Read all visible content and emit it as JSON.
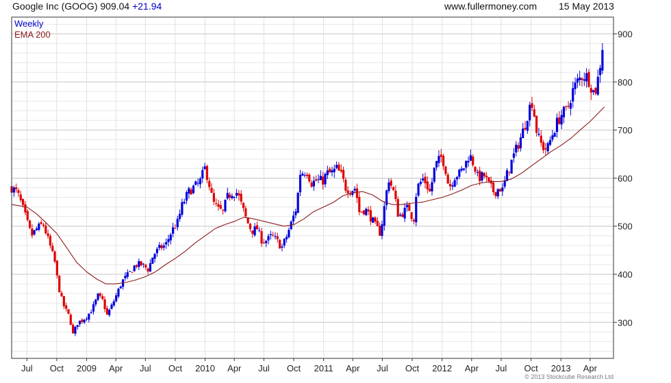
{
  "header": {
    "title": "Google Inc (GOOG) 909.04",
    "change": "+21.94",
    "site": "www.fullermoney.com",
    "date": "15 May 2013"
  },
  "footer": {
    "copyright": "© 2013 Stockcube Research Ltd"
  },
  "colors": {
    "up": "#0000dd",
    "down": "#dd0000",
    "ema": "#8b1a1a",
    "grid": "#c8c8c8",
    "axis": "#333333"
  },
  "chart_data": {
    "type": "candlestick",
    "frequency": "weekly",
    "legend": [
      "Weekly",
      "EMA 200"
    ],
    "legend_placement": "top-left",
    "y_axis": {
      "position": "right",
      "ticks": [
        300,
        400,
        500,
        600,
        700,
        800,
        900
      ],
      "range": [
        225,
        935
      ]
    },
    "grid": true,
    "x_ticks": [
      {
        "label": "Jul",
        "date": "2008-07-01"
      },
      {
        "label": "Oct",
        "date": "2008-10-01"
      },
      {
        "label": "2009",
        "date": "2009-01-01"
      },
      {
        "label": "Apr",
        "date": "2009-04-01"
      },
      {
        "label": "Jul",
        "date": "2009-07-01"
      },
      {
        "label": "Oct",
        "date": "2009-10-01"
      },
      {
        "label": "2010",
        "date": "2010-01-01"
      },
      {
        "label": "Apr",
        "date": "2010-04-01"
      },
      {
        "label": "Jul",
        "date": "2010-07-01"
      },
      {
        "label": "Oct",
        "date": "2010-10-01"
      },
      {
        "label": "2011",
        "date": "2011-01-01"
      },
      {
        "label": "Apr",
        "date": "2011-04-01"
      },
      {
        "label": "Jul",
        "date": "2011-07-01"
      },
      {
        "label": "Oct",
        "date": "2011-10-01"
      },
      {
        "label": "2012",
        "date": "2012-01-01"
      },
      {
        "label": "Apr",
        "date": "2012-04-01"
      },
      {
        "label": "Jul",
        "date": "2012-07-01"
      },
      {
        "label": "Oct",
        "date": "2012-10-01"
      },
      {
        "label": "2013",
        "date": "2013-01-01"
      },
      {
        "label": "Apr",
        "date": "2013-04-01"
      }
    ],
    "x_range": [
      "2008-05-15",
      "2013-06-12"
    ],
    "price_path": [
      [
        "2008-05-15",
        580
      ],
      [
        "2008-06-01",
        570
      ],
      [
        "2008-06-15",
        545
      ],
      [
        "2008-07-01",
        510
      ],
      [
        "2008-07-15",
        480
      ],
      [
        "2008-08-01",
        495
      ],
      [
        "2008-08-20",
        505
      ],
      [
        "2008-09-10",
        460
      ],
      [
        "2008-09-25",
        425
      ],
      [
        "2008-10-05",
        380
      ],
      [
        "2008-10-15",
        350
      ],
      [
        "2008-10-25",
        330
      ],
      [
        "2008-11-10",
        310
      ],
      [
        "2008-11-20",
        275
      ],
      [
        "2008-12-05",
        300
      ],
      [
        "2008-12-20",
        305
      ],
      [
        "2009-01-05",
        315
      ],
      [
        "2009-01-20",
        330
      ],
      [
        "2009-02-05",
        355
      ],
      [
        "2009-02-20",
        345
      ],
      [
        "2009-03-05",
        315
      ],
      [
        "2009-03-20",
        335
      ],
      [
        "2009-04-05",
        360
      ],
      [
        "2009-04-20",
        385
      ],
      [
        "2009-05-10",
        400
      ],
      [
        "2009-06-01",
        420
      ],
      [
        "2009-06-20",
        420
      ],
      [
        "2009-07-10",
        410
      ],
      [
        "2009-07-25",
        440
      ],
      [
        "2009-08-15",
        455
      ],
      [
        "2009-09-01",
        460
      ],
      [
        "2009-09-20",
        490
      ],
      [
        "2009-10-10",
        510
      ],
      [
        "2009-10-20",
        540
      ],
      [
        "2009-11-10",
        570
      ],
      [
        "2009-11-25",
        580
      ],
      [
        "2009-12-15",
        590
      ],
      [
        "2009-12-31",
        620
      ],
      [
        "2010-01-10",
        600
      ],
      [
        "2010-01-25",
        550
      ],
      [
        "2010-02-10",
        535
      ],
      [
        "2010-02-25",
        530
      ],
      [
        "2010-03-10",
        560
      ],
      [
        "2010-03-25",
        570
      ],
      [
        "2010-04-10",
        570
      ],
      [
        "2010-04-25",
        540
      ],
      [
        "2010-05-10",
        510
      ],
      [
        "2010-05-25",
        490
      ],
      [
        "2010-06-10",
        495
      ],
      [
        "2010-06-25",
        470
      ],
      [
        "2010-07-10",
        470
      ],
      [
        "2010-07-25",
        480
      ],
      [
        "2010-08-10",
        470
      ],
      [
        "2010-08-25",
        455
      ],
      [
        "2010-09-10",
        480
      ],
      [
        "2010-09-25",
        510
      ],
      [
        "2010-10-10",
        540
      ],
      [
        "2010-10-20",
        610
      ],
      [
        "2010-11-10",
        615
      ],
      [
        "2010-11-25",
        590
      ],
      [
        "2010-12-10",
        595
      ],
      [
        "2010-12-31",
        595
      ],
      [
        "2011-01-10",
        610
      ],
      [
        "2011-01-25",
        610
      ],
      [
        "2011-02-10",
        620
      ],
      [
        "2011-02-25",
        605
      ],
      [
        "2011-03-10",
        580
      ],
      [
        "2011-03-25",
        575
      ],
      [
        "2011-04-10",
        580
      ],
      [
        "2011-04-20",
        530
      ],
      [
        "2011-05-10",
        535
      ],
      [
        "2011-05-25",
        520
      ],
      [
        "2011-06-10",
        500
      ],
      [
        "2011-06-25",
        485
      ],
      [
        "2011-07-05",
        530
      ],
      [
        "2011-07-20",
        600
      ],
      [
        "2011-08-05",
        570
      ],
      [
        "2011-08-20",
        520
      ],
      [
        "2011-09-05",
        530
      ],
      [
        "2011-09-20",
        540
      ],
      [
        "2011-10-05",
        510
      ],
      [
        "2011-10-15",
        580
      ],
      [
        "2011-11-05",
        600
      ],
      [
        "2011-11-25",
        570
      ],
      [
        "2011-12-10",
        625
      ],
      [
        "2011-12-31",
        645
      ],
      [
        "2012-01-10",
        625
      ],
      [
        "2012-01-22",
        580
      ],
      [
        "2012-02-10",
        605
      ],
      [
        "2012-02-25",
        610
      ],
      [
        "2012-03-10",
        625
      ],
      [
        "2012-03-25",
        650
      ],
      [
        "2012-04-10",
        625
      ],
      [
        "2012-04-20",
        600
      ],
      [
        "2012-05-10",
        605
      ],
      [
        "2012-05-25",
        585
      ],
      [
        "2012-06-10",
        570
      ],
      [
        "2012-06-25",
        580
      ],
      [
        "2012-07-05",
        575
      ],
      [
        "2012-07-20",
        610
      ],
      [
        "2012-08-05",
        640
      ],
      [
        "2012-08-25",
        675
      ],
      [
        "2012-09-10",
        705
      ],
      [
        "2012-09-25",
        745
      ],
      [
        "2012-10-05",
        760
      ],
      [
        "2012-10-20",
        690
      ],
      [
        "2012-11-05",
        665
      ],
      [
        "2012-11-20",
        660
      ],
      [
        "2012-12-05",
        690
      ],
      [
        "2012-12-20",
        715
      ],
      [
        "2013-01-05",
        735
      ],
      [
        "2013-01-20",
        740
      ],
      [
        "2013-02-05",
        780
      ],
      [
        "2013-02-20",
        800
      ],
      [
        "2013-03-10",
        815
      ],
      [
        "2013-03-25",
        810
      ],
      [
        "2013-04-10",
        780
      ],
      [
        "2013-04-20",
        785
      ],
      [
        "2013-05-05",
        850
      ],
      [
        "2013-05-15",
        909
      ]
    ],
    "ema_200": [
      [
        "2008-05-15",
        545
      ],
      [
        "2008-07-01",
        540
      ],
      [
        "2008-08-01",
        525
      ],
      [
        "2008-09-01",
        505
      ],
      [
        "2008-10-01",
        485
      ],
      [
        "2008-11-01",
        455
      ],
      [
        "2008-12-01",
        425
      ],
      [
        "2009-01-01",
        405
      ],
      [
        "2009-02-01",
        390
      ],
      [
        "2009-03-01",
        380
      ],
      [
        "2009-04-01",
        380
      ],
      [
        "2009-05-01",
        383
      ],
      [
        "2009-06-01",
        388
      ],
      [
        "2009-07-01",
        395
      ],
      [
        "2009-08-01",
        405
      ],
      [
        "2009-09-01",
        420
      ],
      [
        "2009-10-01",
        433
      ],
      [
        "2009-11-01",
        448
      ],
      [
        "2009-12-01",
        465
      ],
      [
        "2010-01-01",
        480
      ],
      [
        "2010-02-01",
        495
      ],
      [
        "2010-03-01",
        503
      ],
      [
        "2010-04-01",
        510
      ],
      [
        "2010-05-01",
        519
      ],
      [
        "2010-06-01",
        515
      ],
      [
        "2010-07-01",
        510
      ],
      [
        "2010-08-01",
        505
      ],
      [
        "2010-09-01",
        500
      ],
      [
        "2010-10-01",
        503
      ],
      [
        "2010-11-01",
        515
      ],
      [
        "2010-12-01",
        530
      ],
      [
        "2011-01-01",
        540
      ],
      [
        "2011-02-01",
        550
      ],
      [
        "2011-03-01",
        563
      ],
      [
        "2011-04-01",
        570
      ],
      [
        "2011-05-01",
        572
      ],
      [
        "2011-06-01",
        565
      ],
      [
        "2011-07-01",
        552
      ],
      [
        "2011-08-01",
        545
      ],
      [
        "2011-09-01",
        545
      ],
      [
        "2011-10-01",
        548
      ],
      [
        "2011-11-01",
        550
      ],
      [
        "2011-12-01",
        555
      ],
      [
        "2012-01-01",
        560
      ],
      [
        "2012-02-01",
        567
      ],
      [
        "2012-03-01",
        575
      ],
      [
        "2012-04-01",
        585
      ],
      [
        "2012-05-01",
        590
      ],
      [
        "2012-06-01",
        593
      ],
      [
        "2012-07-01",
        593
      ],
      [
        "2012-08-01",
        598
      ],
      [
        "2012-09-01",
        610
      ],
      [
        "2012-10-01",
        625
      ],
      [
        "2012-11-01",
        640
      ],
      [
        "2012-12-01",
        655
      ],
      [
        "2013-01-01",
        668
      ],
      [
        "2013-02-01",
        683
      ],
      [
        "2013-03-01",
        700
      ],
      [
        "2013-04-01",
        718
      ],
      [
        "2013-05-15",
        748
      ]
    ]
  }
}
